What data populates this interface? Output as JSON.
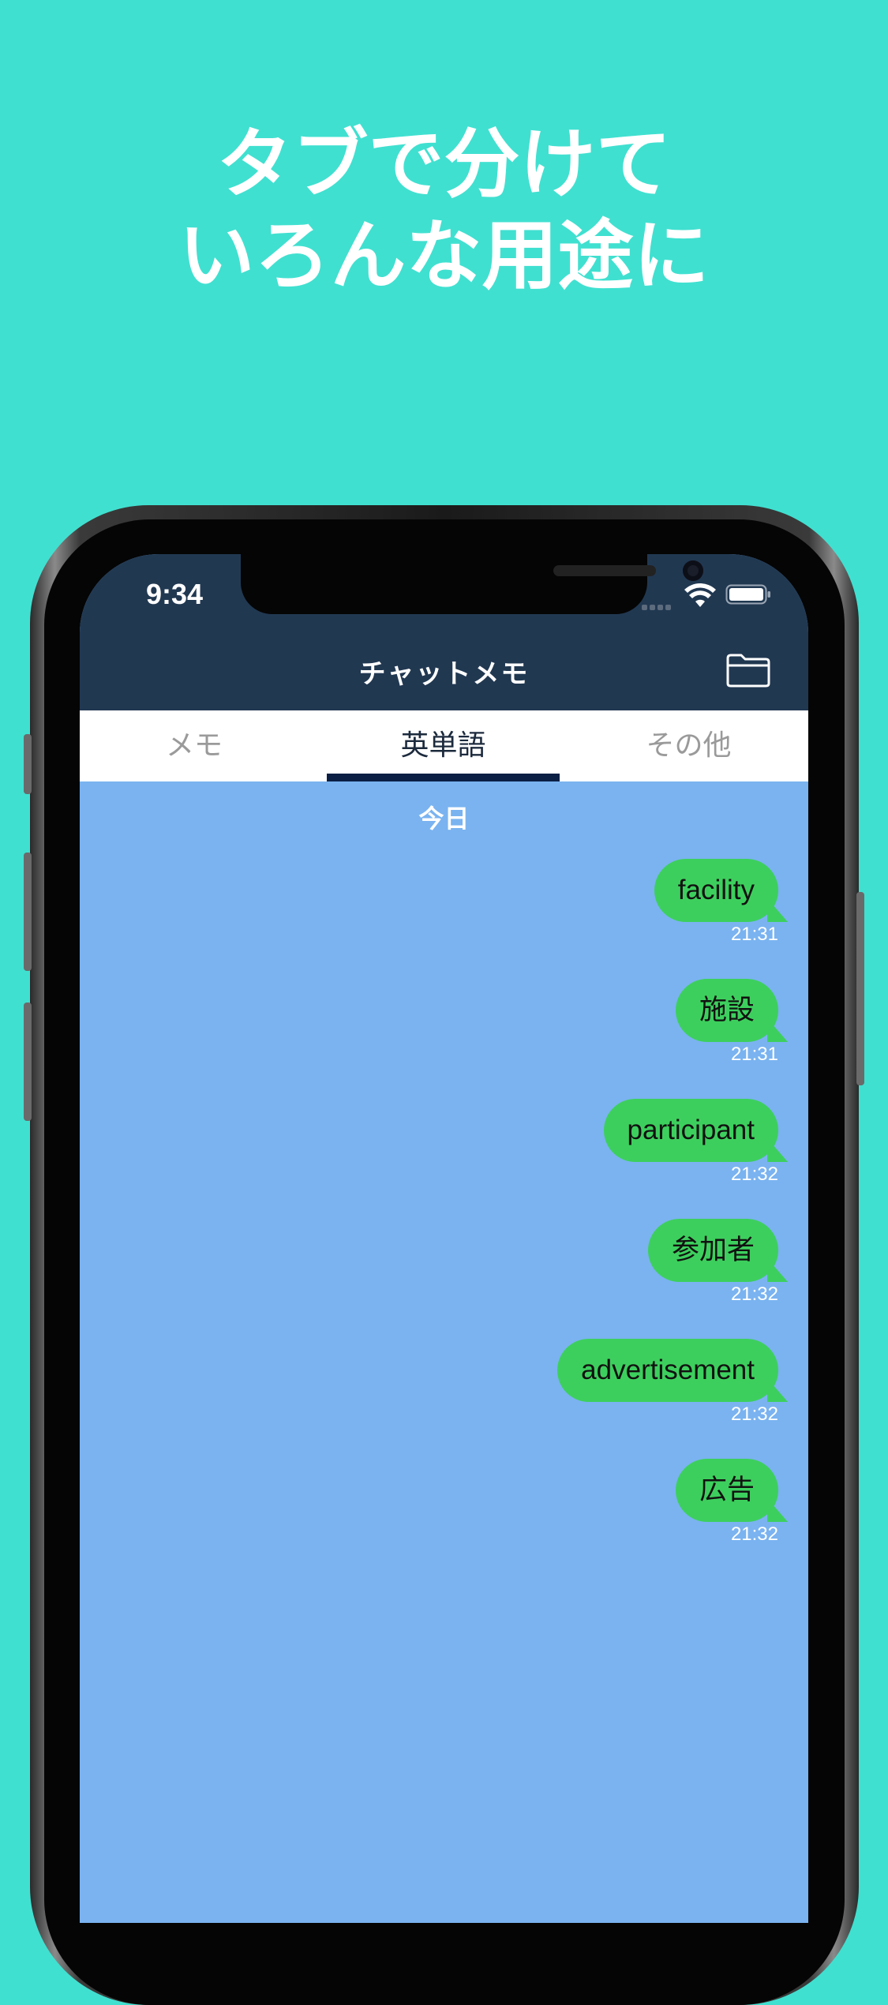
{
  "headline": {
    "line1": "タブで分けて",
    "line2": "いろんな用途に"
  },
  "status_bar": {
    "time": "9:34"
  },
  "nav": {
    "title": "チャットメモ"
  },
  "tabs": [
    {
      "label": "メモ",
      "active": false
    },
    {
      "label": "英単語",
      "active": true
    },
    {
      "label": "その他",
      "active": false
    }
  ],
  "chat": {
    "date_label": "今日",
    "messages": [
      {
        "text": "facility",
        "time": "21:31"
      },
      {
        "text": "施設",
        "time": "21:31"
      },
      {
        "text": "participant",
        "time": "21:32"
      },
      {
        "text": "参加者",
        "time": "21:32"
      },
      {
        "text": "advertisement",
        "time": "21:32"
      },
      {
        "text": "広告",
        "time": "21:32"
      }
    ]
  },
  "icons": {
    "wifi": "wifi-icon",
    "battery": "battery-icon",
    "folder": "folder-icon"
  },
  "colors": {
    "background": "#40E0D0",
    "nav_bar": "#213851",
    "chat_background": "#7AB3F0",
    "bubble": "#3DCF5D",
    "tab_indicator": "#0B1F45"
  }
}
